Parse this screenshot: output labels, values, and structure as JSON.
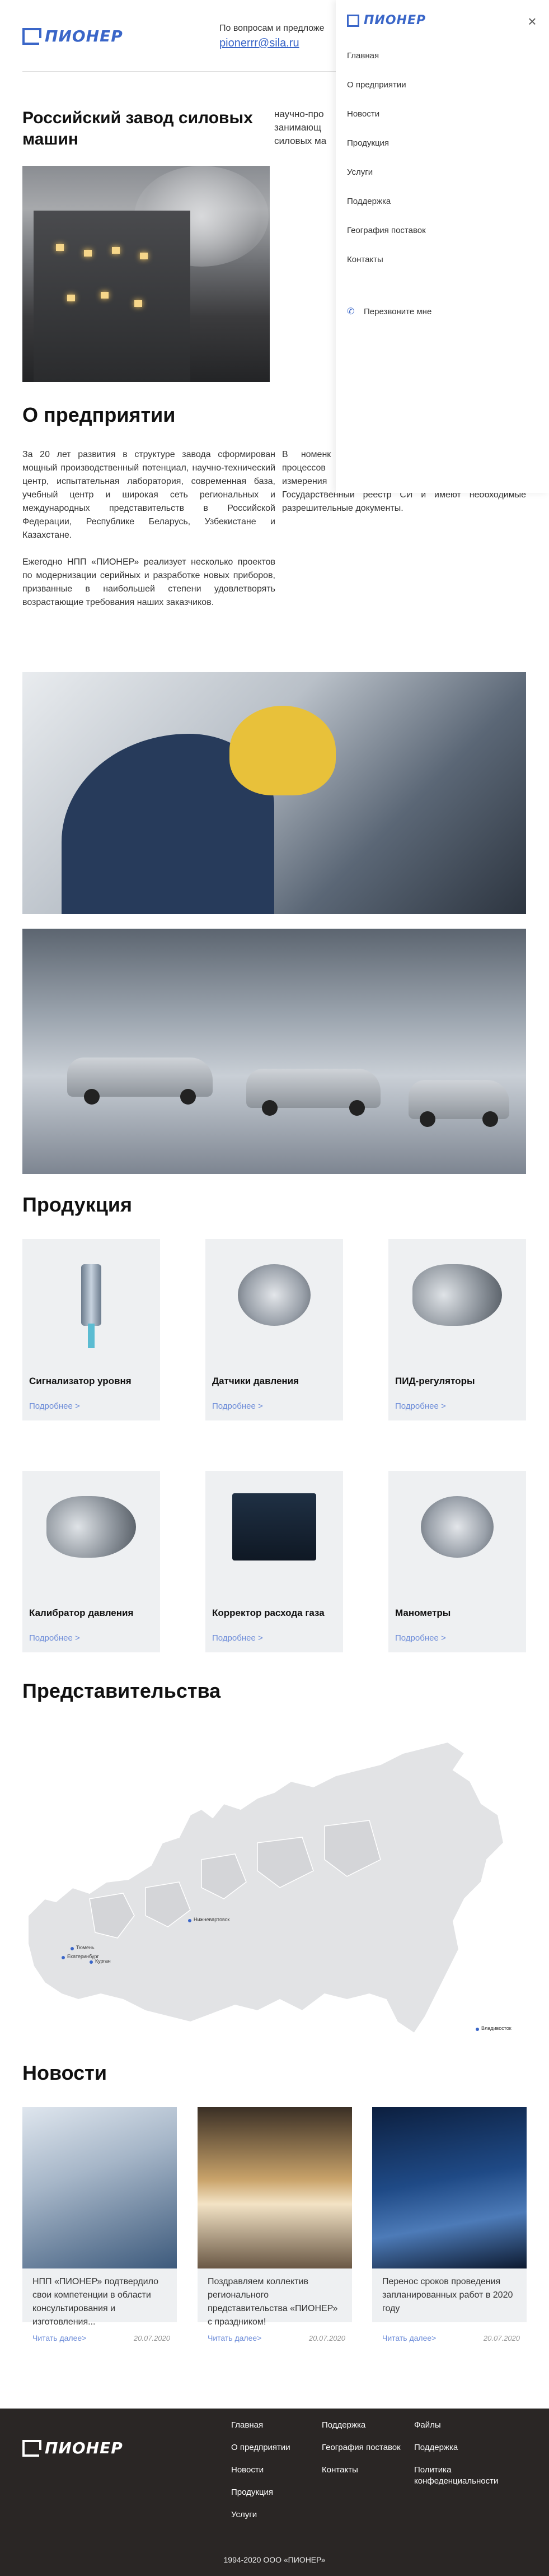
{
  "brand": {
    "name": "ПИОНЕР",
    "color": "#3a66c8"
  },
  "header": {
    "contact_label": "По вопросам и предложе",
    "email": "pionerrr@sila.ru"
  },
  "side_menu": {
    "close_icon": "close-icon",
    "items": [
      {
        "label": "Главная"
      },
      {
        "label": "О предприятии"
      },
      {
        "label": "Новости"
      },
      {
        "label": "Продукция"
      },
      {
        "label": "Услуги"
      },
      {
        "label": "Поддержка"
      },
      {
        "label": "География поставок"
      },
      {
        "label": "Контакты"
      }
    ],
    "callback_label": "Перезвоните мне",
    "callback_icon": "phone-icon"
  },
  "hero": {
    "title": "Российский завод силовых машин",
    "aside": "научно-про занимающ силовых ма"
  },
  "about": {
    "title": "О предприятии",
    "col1_p1": "За 20 лет развития в структуре завода сформирован мощный производственный потенциал, научно-технический центр, испытательная лаборатория, современная база, учебный центр и широкая сеть региональных и международных представительств в Российской Федерации, Республике Беларусь, Узбекистане и Казахстане.",
    "col1_p2": "Ежегодно НПП «ПИОНЕР» реализует несколько проектов по модернизации серийных и разработке новых приборов, призванные в наибольшей степени удовлетворять возрастающие требования наших заказчиков.",
    "col2_text": "В номенк продукции успешного технологических процессов на любом предприятии. Все средства измерения производства «ПИОНЕР» внесены в Государственный реестр СИ и имеют необходимые разрешительные документы."
  },
  "products": {
    "title": "Продукция",
    "more_label": "Подробнее >",
    "items": [
      {
        "name": "Сигнализатор уровня"
      },
      {
        "name": "Датчики давления"
      },
      {
        "name": "ПИД-регуляторы"
      },
      {
        "name": "Калибратор давления"
      },
      {
        "name": "Корректор расхода газа"
      },
      {
        "name": "Манометры"
      }
    ]
  },
  "representations": {
    "title": "Представительства",
    "cities": [
      {
        "name": "Нижневартовск"
      },
      {
        "name": "Тюмень"
      },
      {
        "name": "Екатеринбург"
      },
      {
        "name": "Курган"
      },
      {
        "name": "Владивосток"
      }
    ]
  },
  "news": {
    "title": "Новости",
    "more_label": "Читать далее>",
    "items": [
      {
        "text": "НПП «ПИОНЕР» подтвердило свои компетенции в области консультирования и изготовления...",
        "date": "20.07.2020"
      },
      {
        "text": "Поздравляем коллектив регионального представительства «ПИОНЕР» с праздником!",
        "date": "20.07.2020"
      },
      {
        "text": "Перенос сроков проведения запланированных работ в 2020 году",
        "date": "20.07.2020"
      }
    ]
  },
  "footer": {
    "col1": [
      "Главная",
      "О предприятии",
      "Новости",
      "Продукция",
      "Услуги"
    ],
    "col2": [
      "Поддержка",
      "География поставок",
      "Контакты"
    ],
    "col3": [
      "Файлы",
      "Поддержка",
      "Политика конфеденциальности"
    ],
    "copyright": "1994-2020 ООО «ПИОНЕР»"
  }
}
